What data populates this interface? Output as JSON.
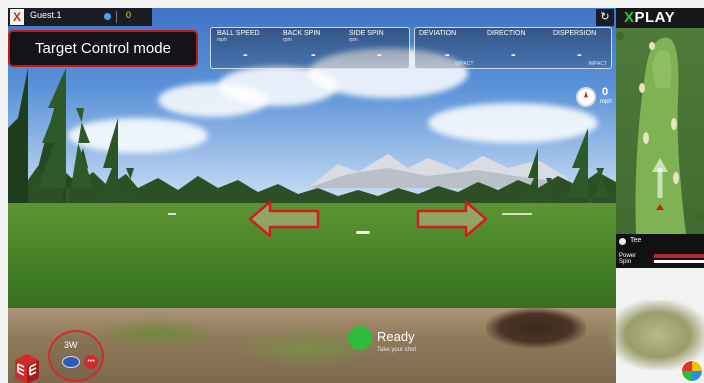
{
  "user": {
    "name": "Guest.1",
    "score": "0",
    "logo": "X"
  },
  "stats": {
    "ball_speed": {
      "label": "BALL SPEED",
      "unit": "mph",
      "value": "-"
    },
    "back_spin": {
      "label": "BACK SPIN",
      "unit": "rpm",
      "value": "-"
    },
    "side_spin": {
      "label": "SIDE SPIN",
      "unit": "rpm",
      "value": "-"
    },
    "deviation": {
      "label": "DEVIATION",
      "value": "-"
    },
    "direction": {
      "label": "DIRECTION",
      "value": "-"
    },
    "dispersion": {
      "label": "DISPERSION",
      "value": "-"
    },
    "impact_label": "IMPACT"
  },
  "mode_popup": "Target Control mode",
  "brand": {
    "x": "X",
    "name": "PLAY"
  },
  "refresh_icon": "↻",
  "wind": {
    "value": "0",
    "unit": "mph"
  },
  "minimap": {
    "tee_label": "Tee",
    "power_label": "Power",
    "spin_label": "Spin"
  },
  "club": {
    "label": "3W",
    "more": "•••"
  },
  "status": {
    "label": "Ready",
    "sub": "Take your shot"
  },
  "colors": {
    "accent_red": "#d12a2a",
    "brand_green": "#1fd11f",
    "ready_green": "#2dbd3a",
    "score_yellow": "#f3e600"
  },
  "icons": [
    "refresh-icon",
    "wind-compass-icon",
    "left-arrow-icon",
    "right-arrow-icon",
    "golf-club-icon",
    "more-icon",
    "app-logo-icon",
    "chart-pie-icon"
  ]
}
